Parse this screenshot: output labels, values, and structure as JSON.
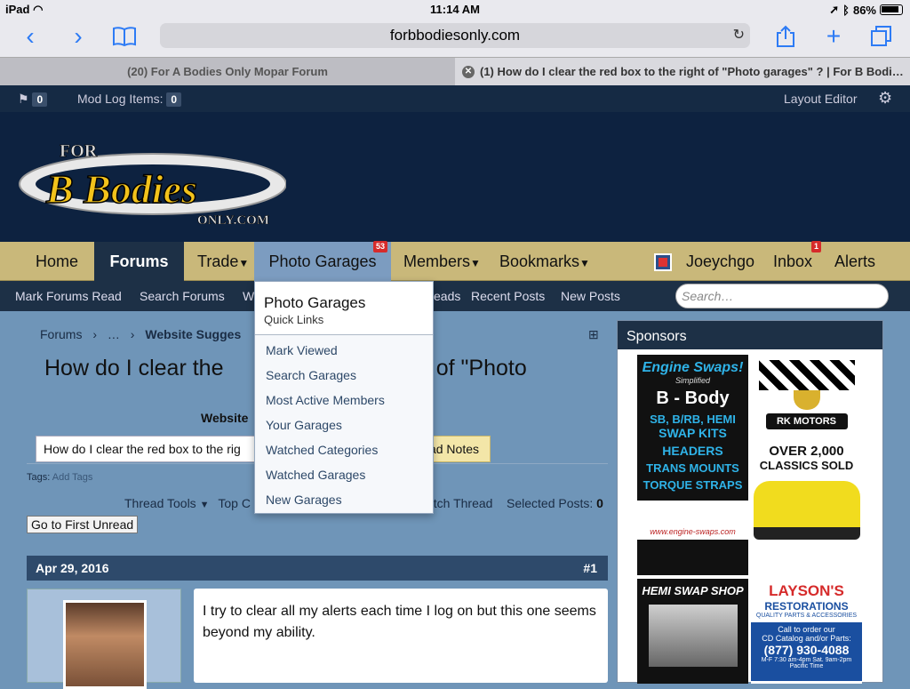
{
  "status_bar": {
    "device": "iPad",
    "time": "11:14 AM",
    "battery": "86%"
  },
  "browser": {
    "url": "forbbodiesonly.com",
    "tabs": [
      {
        "label": "(20) For A Bodies Only Mopar Forum"
      },
      {
        "label": "(1) How do I clear the red box to the right of \"Photo garages\" ? | For B Bodi…"
      }
    ]
  },
  "mod_bar": {
    "flag_count": "0",
    "mod_log_label": "Mod Log Items:",
    "mod_log_count": "0",
    "layout_editor": "Layout Editor"
  },
  "logo": {
    "line1": "FOR",
    "line2": "B Bodies",
    "line3": "ONLY.COM"
  },
  "nav": {
    "home": "Home",
    "forums": "Forums",
    "trade": "Trade",
    "photo_garages": "Photo Garages",
    "photo_garages_badge": "53",
    "members": "Members",
    "bookmarks": "Bookmarks",
    "username": "Joeychgo",
    "inbox": "Inbox",
    "inbox_badge": "1",
    "alerts": "Alerts"
  },
  "subnav": {
    "mark_read": "Mark Forums Read",
    "search_forums": "Search Forums",
    "watched_prefix": "W",
    "threads_suffix": "eads",
    "recent_posts": "Recent Posts",
    "new_posts": "New Posts",
    "search_placeholder": "Search…"
  },
  "dropdown": {
    "title": "Photo Garages",
    "subtitle": "Quick Links",
    "items": [
      "Mark Viewed",
      "Search Garages",
      "Most Active Members",
      "Your Garages",
      "Watched Categories",
      "Watched Garages",
      "New Garages"
    ]
  },
  "main": {
    "breadcrumb": [
      "Forums",
      "…",
      "Website Sugges"
    ],
    "title_left": "How do I clear the",
    "title_right": "ight of \"Photo",
    "forum_label": "Website",
    "note_text": "How do I clear the red box to the rig",
    "thread_notes": "ad Notes",
    "tags_label": "Tags:",
    "add_tags": "Add Tags",
    "thread_tools": "Thread Tools",
    "top_prefix": "Top C",
    "watch_thread": "atch Thread",
    "selected_posts": "Selected Posts:",
    "selected_count": "0",
    "go_first_unread": "Go to First Unread",
    "post_date": "Apr 29, 2016",
    "post_number": "#1",
    "post_text": "I try to clear all my alerts each time I log on but this one seems beyond my ability."
  },
  "sidebar": {
    "title": "Sponsors",
    "ads": [
      {
        "lines": [
          "Engine Swaps!",
          "Simplified",
          "B - Body",
          "SB, B/RB, HEMI",
          "SWAP KITS",
          "HEADERS",
          "TRANS MOUNTS",
          "TORQUE STRAPS",
          "www.engine-swaps.com"
        ]
      },
      {
        "lines": [
          "RK MOTORS",
          "OVER 2,000",
          "CLASSICS SOLD"
        ]
      },
      {
        "lines": [
          "HEMI SWAP SHOP"
        ]
      },
      {
        "lines": [
          "LAYSON'S",
          "RESTORATIONS",
          "QUALITY PARTS & ACCESSORIES",
          "Call to order our",
          "CD Catalog and/or Parts:",
          "(877) 930-4088",
          "M-F 7:30 am-4pm  Sat. 9am-2pm",
          "Pacific Time"
        ]
      }
    ]
  }
}
